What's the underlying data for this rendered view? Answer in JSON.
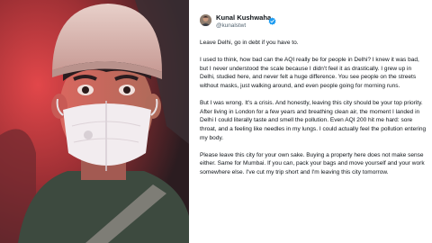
{
  "author": {
    "name": "Kunal Kushwaha",
    "handle": "@kunalstwt",
    "verified_color": "#1d9bf0"
  },
  "tweet": {
    "paragraphs": [
      "Leave Delhi, go in debt if you have to.",
      "I used to think, how bad can the AQI really be for people in Delhi? I knew it was bad, but I never understood the scale because I didn't feel it as drastically. I grew up in Delhi, studied here, and never felt a huge difference. You see people on the streets without masks, just walking around, and even people going for morning runs.",
      "But I was wrong. It's a crisis. And honestly, leaving this city should be your top priority. After living in London for a few years and breathing clean air, the moment I landed in Delhi I could literally taste and smell the pollution. Even AQI 200 hit me hard: sore throat, and a feeling like needles in my lungs. I could actually feel the pollution entering my body.",
      "Please leave this city for your own sake. Buying a property here does not make sense either. Same for Mumbai. If you can, pack your bags and move yourself and your work somewhere else. I've cut my trip short and I'm leaving this city tomorrow."
    ]
  },
  "photo": {
    "icon": "selfie-photo",
    "beanie_color": "#d7b9b3",
    "mask_color": "#f2ecef",
    "ambient_color": "#c23c3f"
  }
}
